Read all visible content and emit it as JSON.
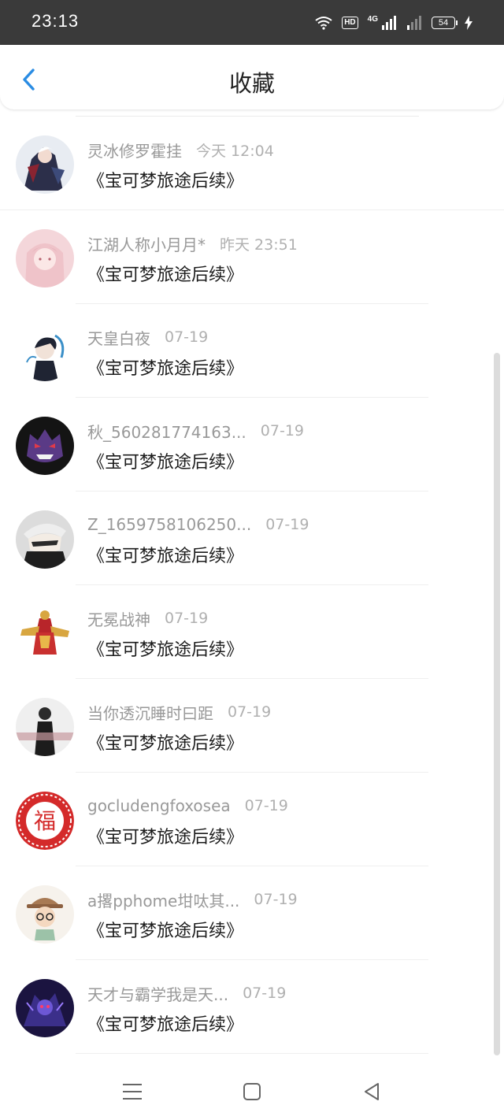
{
  "status_bar": {
    "time": "23:13",
    "network_label": "4G",
    "hd_label": "HD",
    "battery_level": "54",
    "icons": [
      "wifi-icon",
      "hd-icon",
      "signal-icon",
      "signal-icon-secondary",
      "battery-icon",
      "charging-icon"
    ]
  },
  "header": {
    "title": "收藏",
    "back_icon": "chevron-left-icon"
  },
  "colors": {
    "accent": "#2a8ce3",
    "status_bar_bg": "#3a3a3a",
    "name_text": "#999999",
    "title_text": "#1c1c1c"
  },
  "items": [
    {
      "name": "灵冰修罗霍挂",
      "time": "今天 12:04",
      "title": "《宝可梦旅途后续》"
    },
    {
      "name": "江湖人称小月月*",
      "time": "昨天 23:51",
      "title": "《宝可梦旅途后续》"
    },
    {
      "name": "天皇白夜",
      "time": "07-19",
      "title": "《宝可梦旅途后续》"
    },
    {
      "name": "秋_560281774163...",
      "time": "07-19",
      "title": "《宝可梦旅途后续》"
    },
    {
      "name": "Z_1659758106250...",
      "time": "07-19",
      "title": "《宝可梦旅途后续》"
    },
    {
      "name": "无冕战神",
      "time": "07-19",
      "title": "《宝可梦旅途后续》"
    },
    {
      "name": "当你透沉睡时曰距",
      "time": "07-19",
      "title": "《宝可梦旅途后续》"
    },
    {
      "name": "gocludengfoxosea",
      "time": "07-19",
      "title": "《宝可梦旅途后续》"
    },
    {
      "name": "a撂pphome坩呔其...",
      "time": "07-19",
      "title": "《宝可梦旅途后续》"
    },
    {
      "name": "天才与霸学我是天...",
      "time": "07-19",
      "title": "《宝可梦旅途后续》"
    }
  ],
  "avatars": {
    "fu_character": "福"
  },
  "nav_bar": {
    "icons": [
      "menu-icon",
      "home-square-icon",
      "back-triangle-icon"
    ]
  }
}
